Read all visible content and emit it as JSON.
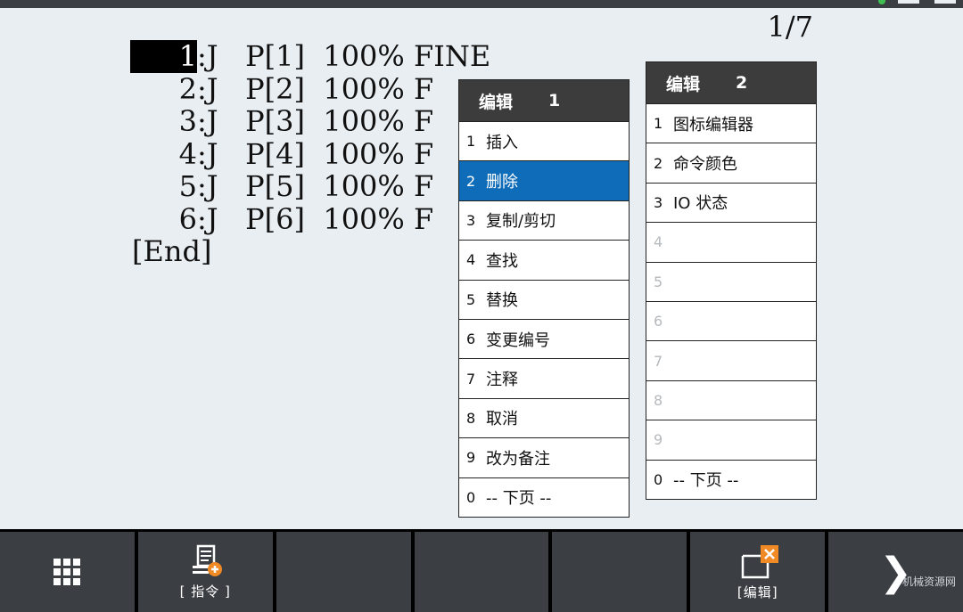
{
  "page_indicator": "1/7",
  "program": {
    "lines": [
      {
        "num": "1",
        "text": ":J   P[1]  100% FINE"
      },
      {
        "num": "2",
        "text": ":J   P[2]  100% F"
      },
      {
        "num": "3",
        "text": ":J   P[3]  100% F"
      },
      {
        "num": "4",
        "text": ":J   P[4]  100% F"
      },
      {
        "num": "5",
        "text": ":J   P[5]  100% F"
      },
      {
        "num": "6",
        "text": ":J   P[6]  100% F"
      }
    ],
    "end_label": "[End]"
  },
  "menu1": {
    "title": "编辑",
    "page": "1",
    "items": [
      {
        "num": "1",
        "label": "插入"
      },
      {
        "num": "2",
        "label": "删除"
      },
      {
        "num": "3",
        "label": "复制/剪切"
      },
      {
        "num": "4",
        "label": "查找"
      },
      {
        "num": "5",
        "label": "替换"
      },
      {
        "num": "6",
        "label": "变更编号"
      },
      {
        "num": "7",
        "label": "注释"
      },
      {
        "num": "8",
        "label": "取消"
      },
      {
        "num": "9",
        "label": "改为备注"
      },
      {
        "num": "0",
        "label": "-- 下页 --"
      }
    ]
  },
  "menu2": {
    "title": "编辑",
    "page": "2",
    "items": [
      {
        "num": "1",
        "label": "图标编辑器"
      },
      {
        "num": "2",
        "label": "命令颜色"
      },
      {
        "num": "3",
        "label": "IO 状态"
      },
      {
        "num": "4",
        "label": ""
      },
      {
        "num": "5",
        "label": ""
      },
      {
        "num": "6",
        "label": ""
      },
      {
        "num": "7",
        "label": ""
      },
      {
        "num": "8",
        "label": ""
      },
      {
        "num": "9",
        "label": ""
      },
      {
        "num": "0",
        "label": "-- 下页 --"
      }
    ]
  },
  "softkeys": {
    "instruction_label": "[ 指令 ]",
    "edit_label": "[编辑]"
  },
  "watermark": "机械资源网",
  "colors": {
    "selected": "#0f6cb8",
    "screen_bg": "#e9eef2",
    "header_bg": "#3c3c3c",
    "accent_orange": "#f08a24"
  }
}
